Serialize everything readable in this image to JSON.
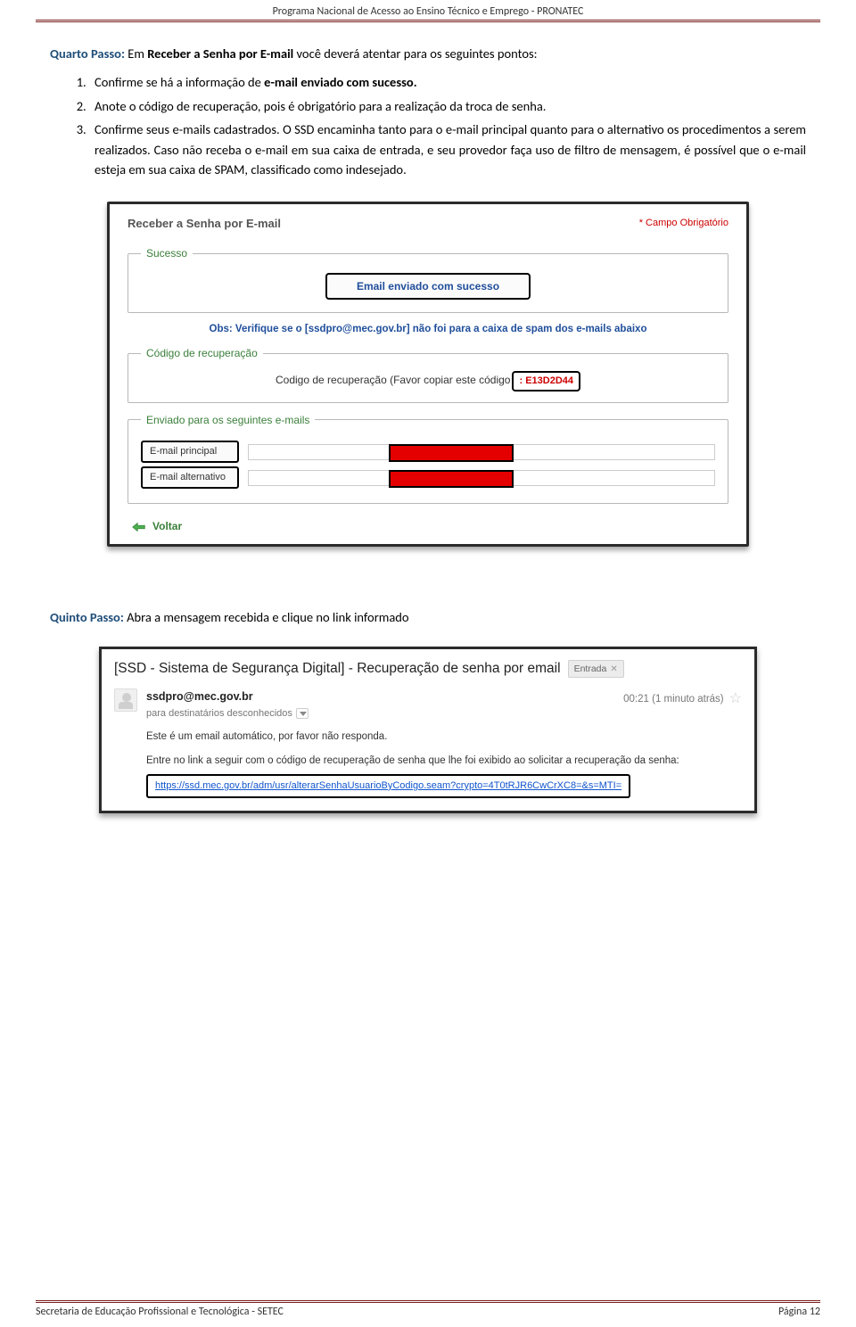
{
  "header": {
    "title": "Programa Nacional de Acesso ao Ensino Técnico e Emprego - PRONATEC"
  },
  "step4": {
    "label": "Quarto Passo:",
    "intro_before": " Em ",
    "intro_bold": "Receber a Senha por E-mail",
    "intro_after": " você deverá atentar para os seguintes pontos:",
    "items": {
      "n1_a": "Confirme se há a informação de ",
      "n1_b": "e-mail enviado com sucesso.",
      "n2": "Anote o código de recuperação, pois é obrigatório para a realização da troca de senha.",
      "n3": "Confirme seus e-mails cadastrados. O SSD encaminha tanto para o e-mail principal quanto para o alternativo os procedimentos a serem realizados. Caso não receba o e-mail em sua caixa de entrada, e seu provedor faça uso de filtro de mensagem, é possível que o e-mail esteja em sua caixa de SPAM, classificado como indesejado."
    }
  },
  "shot1": {
    "title": "Receber a Senha por E-mail",
    "required": "* Campo Obrigatório",
    "legend_success": "Sucesso",
    "success_msg": "Email enviado com sucesso",
    "obs": "Obs: Verifique se o [ssdpro@mec.gov.br] não foi para a caixa de spam dos e-mails abaixo",
    "legend_code": "Código de recuperação",
    "code_prefix": "Codigo de recuperação (Favor copiar este código",
    "code_value": ": E13D2D44",
    "legend_emails": "Enviado para os seguintes e-mails",
    "email_principal": "E-mail principal",
    "email_alt": "E-mail alternativo",
    "voltar": "Voltar"
  },
  "step5": {
    "label": "Quinto Passo:",
    "text": " Abra a mensagem recebida e clique no link informado"
  },
  "shot2": {
    "subject": "[SSD - Sistema de Segurança Digital] - Recuperação de senha por email",
    "inbox_chip": "Entrada",
    "from": "ssdpro@mec.gov.br",
    "to": "para destinatários desconhecidos",
    "time": "00:21 (1 minuto atrás)",
    "body_line1": "Este é um email automático, por favor não responda.",
    "body_line2": "Entre no link a seguir com o código de recuperação de senha que lhe foi exibido ao solicitar a recuperação da senha:",
    "link": "https://ssd.mec.gov.br/adm/usr/alterarSenhaUsuarioByCodigo.seam?crypto=4T0tRJR6CwCrXC8=&s=MTI="
  },
  "footer": {
    "left": "Secretaria de Educação Profissional e Tecnológica - SETEC",
    "right": "Página 12"
  }
}
